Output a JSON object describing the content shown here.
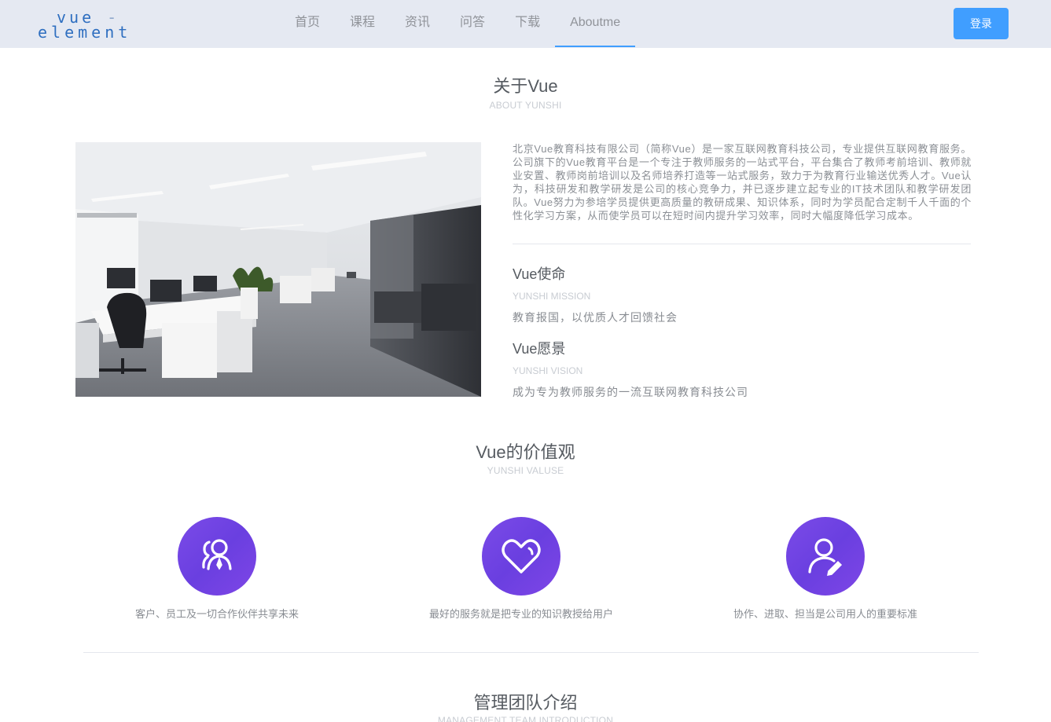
{
  "header": {
    "logo_line1": "vue",
    "logo_dash": "-",
    "logo_line2": "element",
    "nav": [
      {
        "label": "首页"
      },
      {
        "label": "课程"
      },
      {
        "label": "资讯"
      },
      {
        "label": "问答"
      },
      {
        "label": "下载"
      },
      {
        "label": "Aboutme",
        "active": true
      }
    ],
    "login_label": "登录",
    "accent_color": "#409eff"
  },
  "about": {
    "title": "关于Vue",
    "subtitle": "ABOUT YUNSHI",
    "intro": "北京Vue教育科技有限公司（简称Vue）是一家互联网教育科技公司，专业提供互联网教育服务。公司旗下的Vue教育平台是一个专注于教师服务的一站式平台，平台集合了教师考前培训、教师就业安置、教师岗前培训以及名师培养打造等一站式服务，致力于为教育行业输送优秀人才。Vue认为，科技研发和教学研发是公司的核心竞争力，并已逐步建立起专业的IT技术团队和教学研发团队。Vue努力为参培学员提供更高质量的教研成果、知识体系，同时为学员配合定制千人千面的个性化学习方案，从而使学员可以在短时间内提升学习效率，同时大幅度降低学习成本。",
    "mission": {
      "title": "Vue使命",
      "en": "YUNSHI MISSION",
      "text": "教育报国，以优质人才回馈社会"
    },
    "vision": {
      "title": "Vue愿景",
      "en": "YUNSHI VISION",
      "text": "成为专为教师服务的一流互联网教育科技公司"
    }
  },
  "values": {
    "title": "Vue的价值观",
    "subtitle": "YUNSHI VALUSE",
    "items": [
      {
        "icon": "team-users-icon",
        "text": "客户、员工及一切合作伙伴共享未来"
      },
      {
        "icon": "heart-icon",
        "text": "最好的服务就是把专业的知识教授给用户"
      },
      {
        "icon": "user-edit-icon",
        "text": "协作、进取、担当是公司用人的重要标准"
      }
    ],
    "icon_color": "#7045e6"
  },
  "team": {
    "title": "管理团队介绍",
    "subtitle": "MANAGEMENT TEAM INTRODUCTION"
  }
}
